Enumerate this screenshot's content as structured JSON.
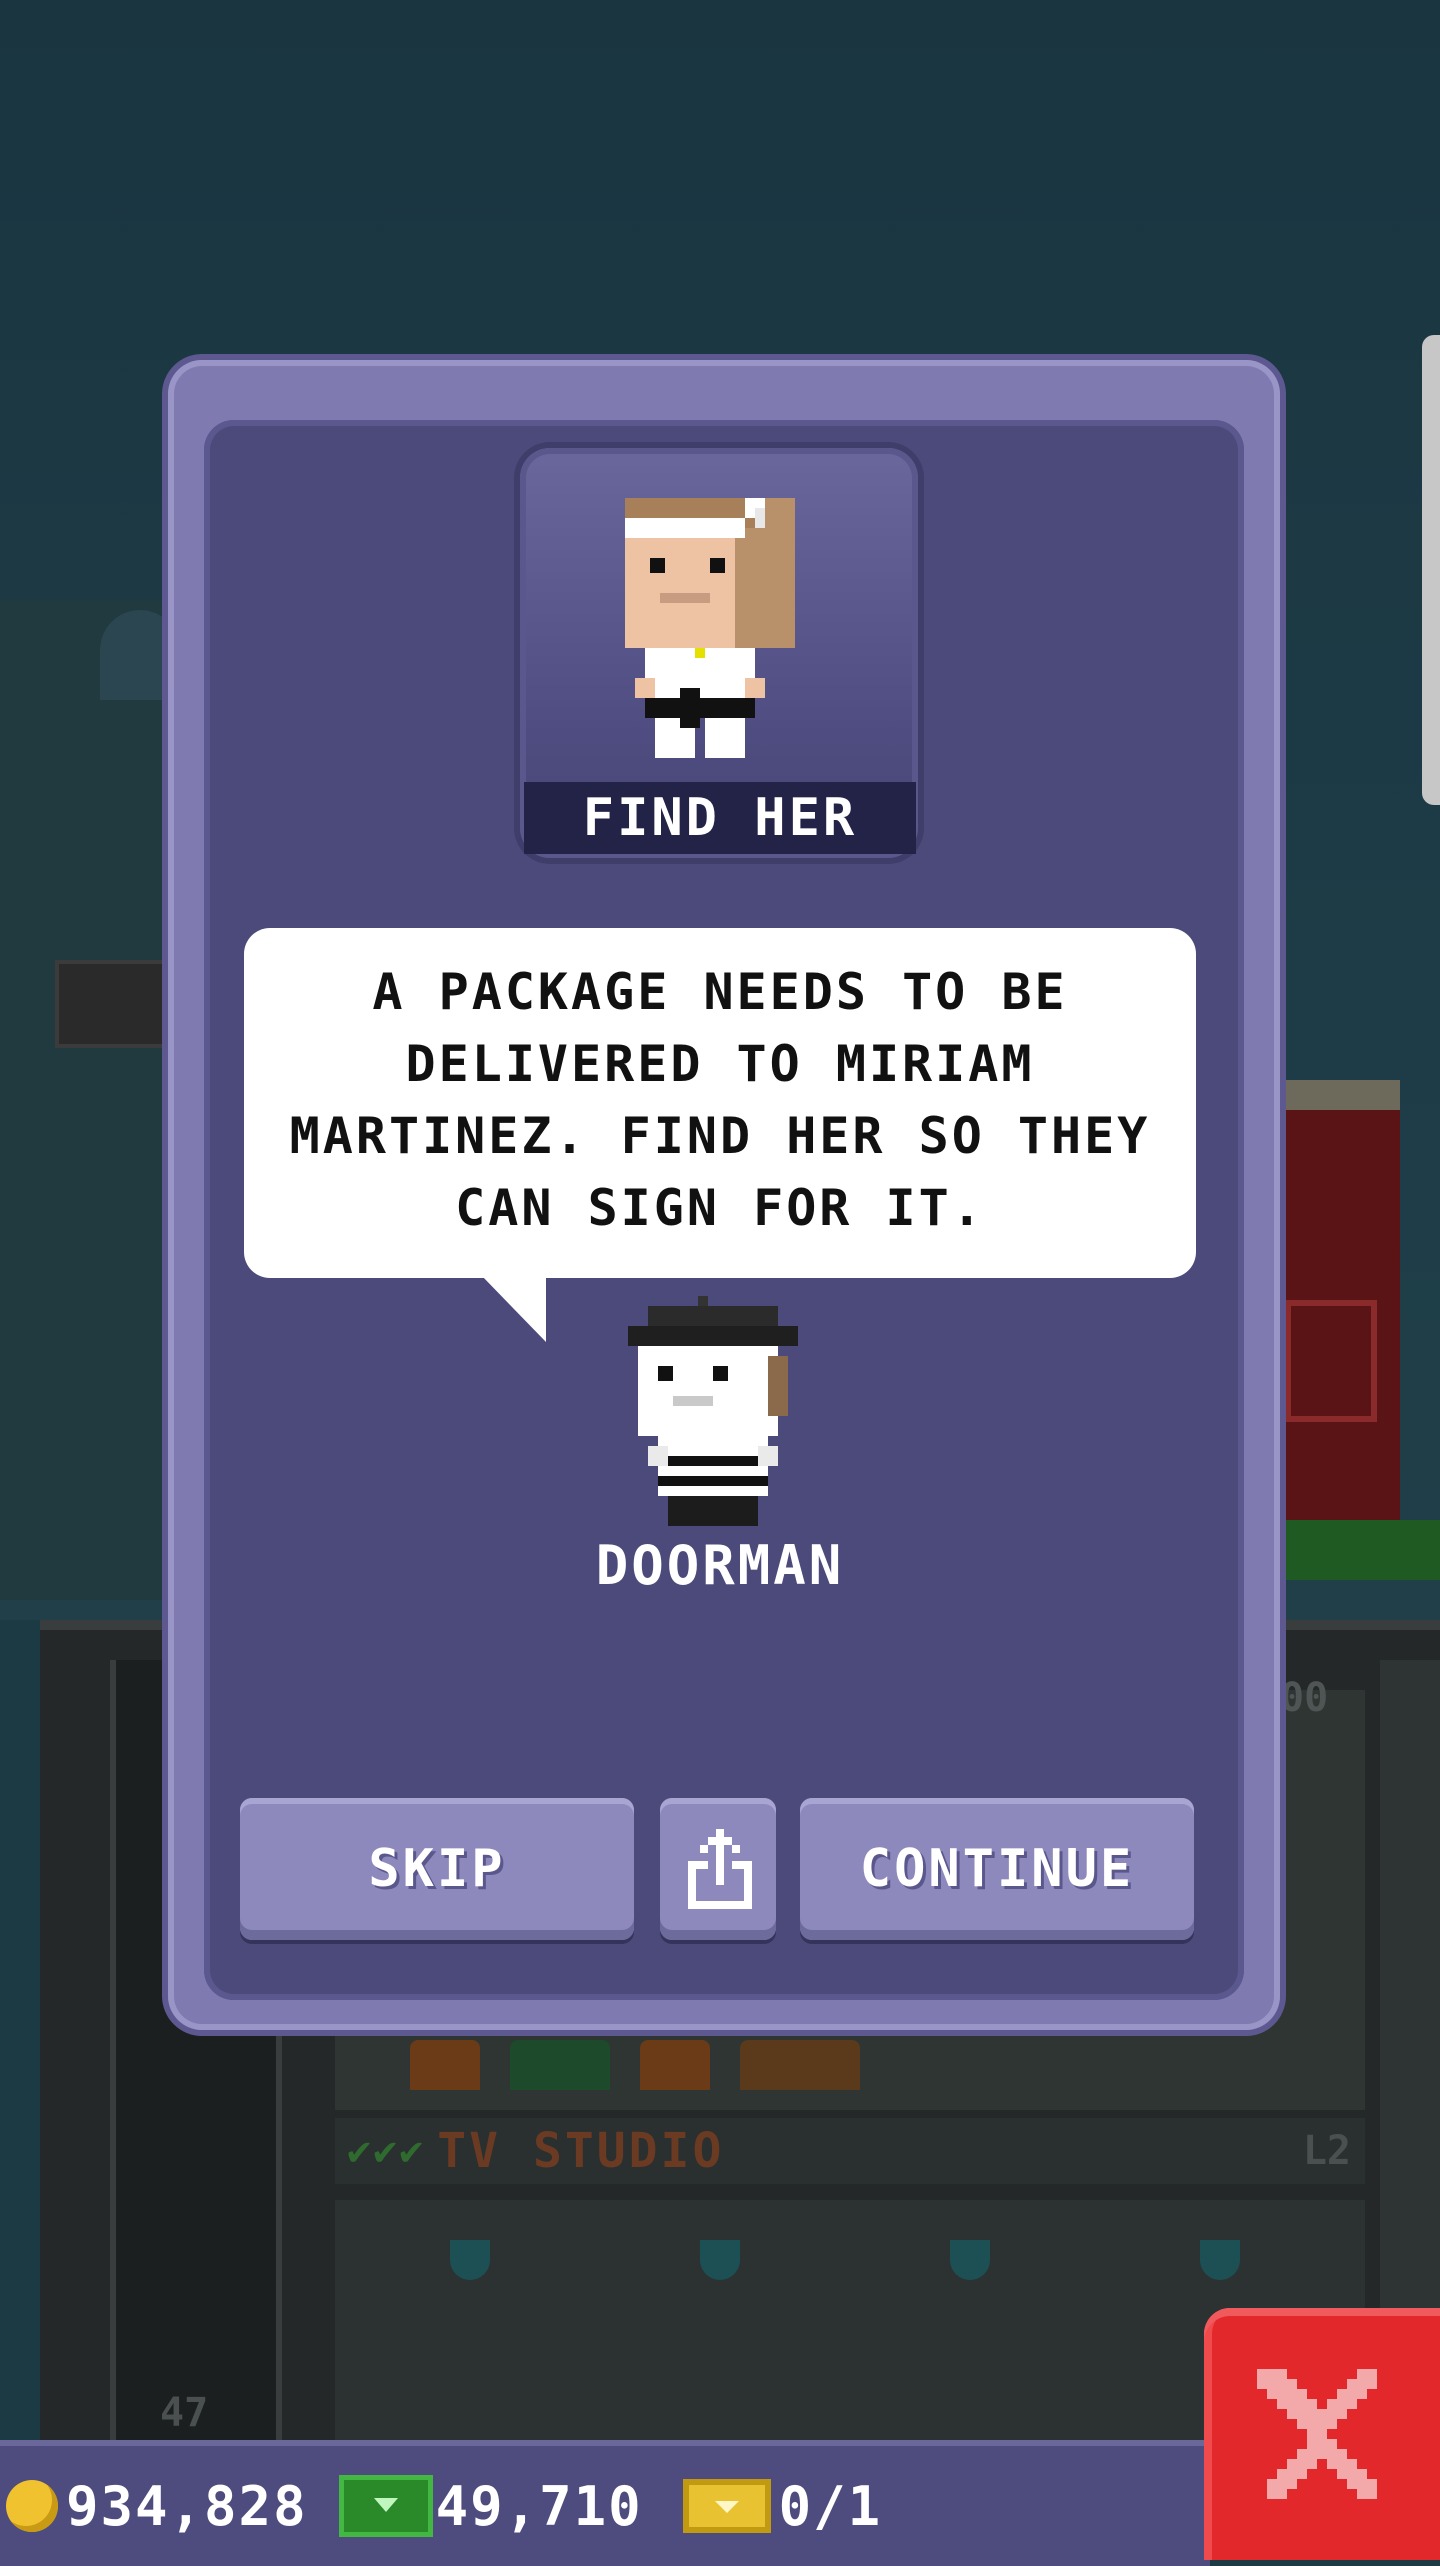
{
  "mission": {
    "title": "FIND HER",
    "message": "A PACKAGE NEEDS TO BE DELIVERED TO MIRIAM MARTINEZ. FIND HER SO THEY CAN SIGN FOR IT.",
    "speaker": "DOORMAN"
  },
  "buttons": {
    "skip": "SKIP",
    "continue": "CONTINUE",
    "share_icon": "share-icon",
    "close_icon": "close-icon"
  },
  "currency": {
    "coins": "934,828",
    "bux": "49,710",
    "tickets": "0/1"
  },
  "background": {
    "floor_name": "TV STUDIO",
    "floor_level": "L2",
    "floor_checks": "✔✔✔",
    "floor_number": "47",
    "upper_floor_value": "00"
  },
  "colors": {
    "panel": "#7f7aaf",
    "panel_inner": "#4c4a7a",
    "button": "#8d89bd",
    "close_button": "#e3282c",
    "coin": "#f0c230",
    "bux": "#2a8a2a",
    "ticket": "#e9c231"
  }
}
